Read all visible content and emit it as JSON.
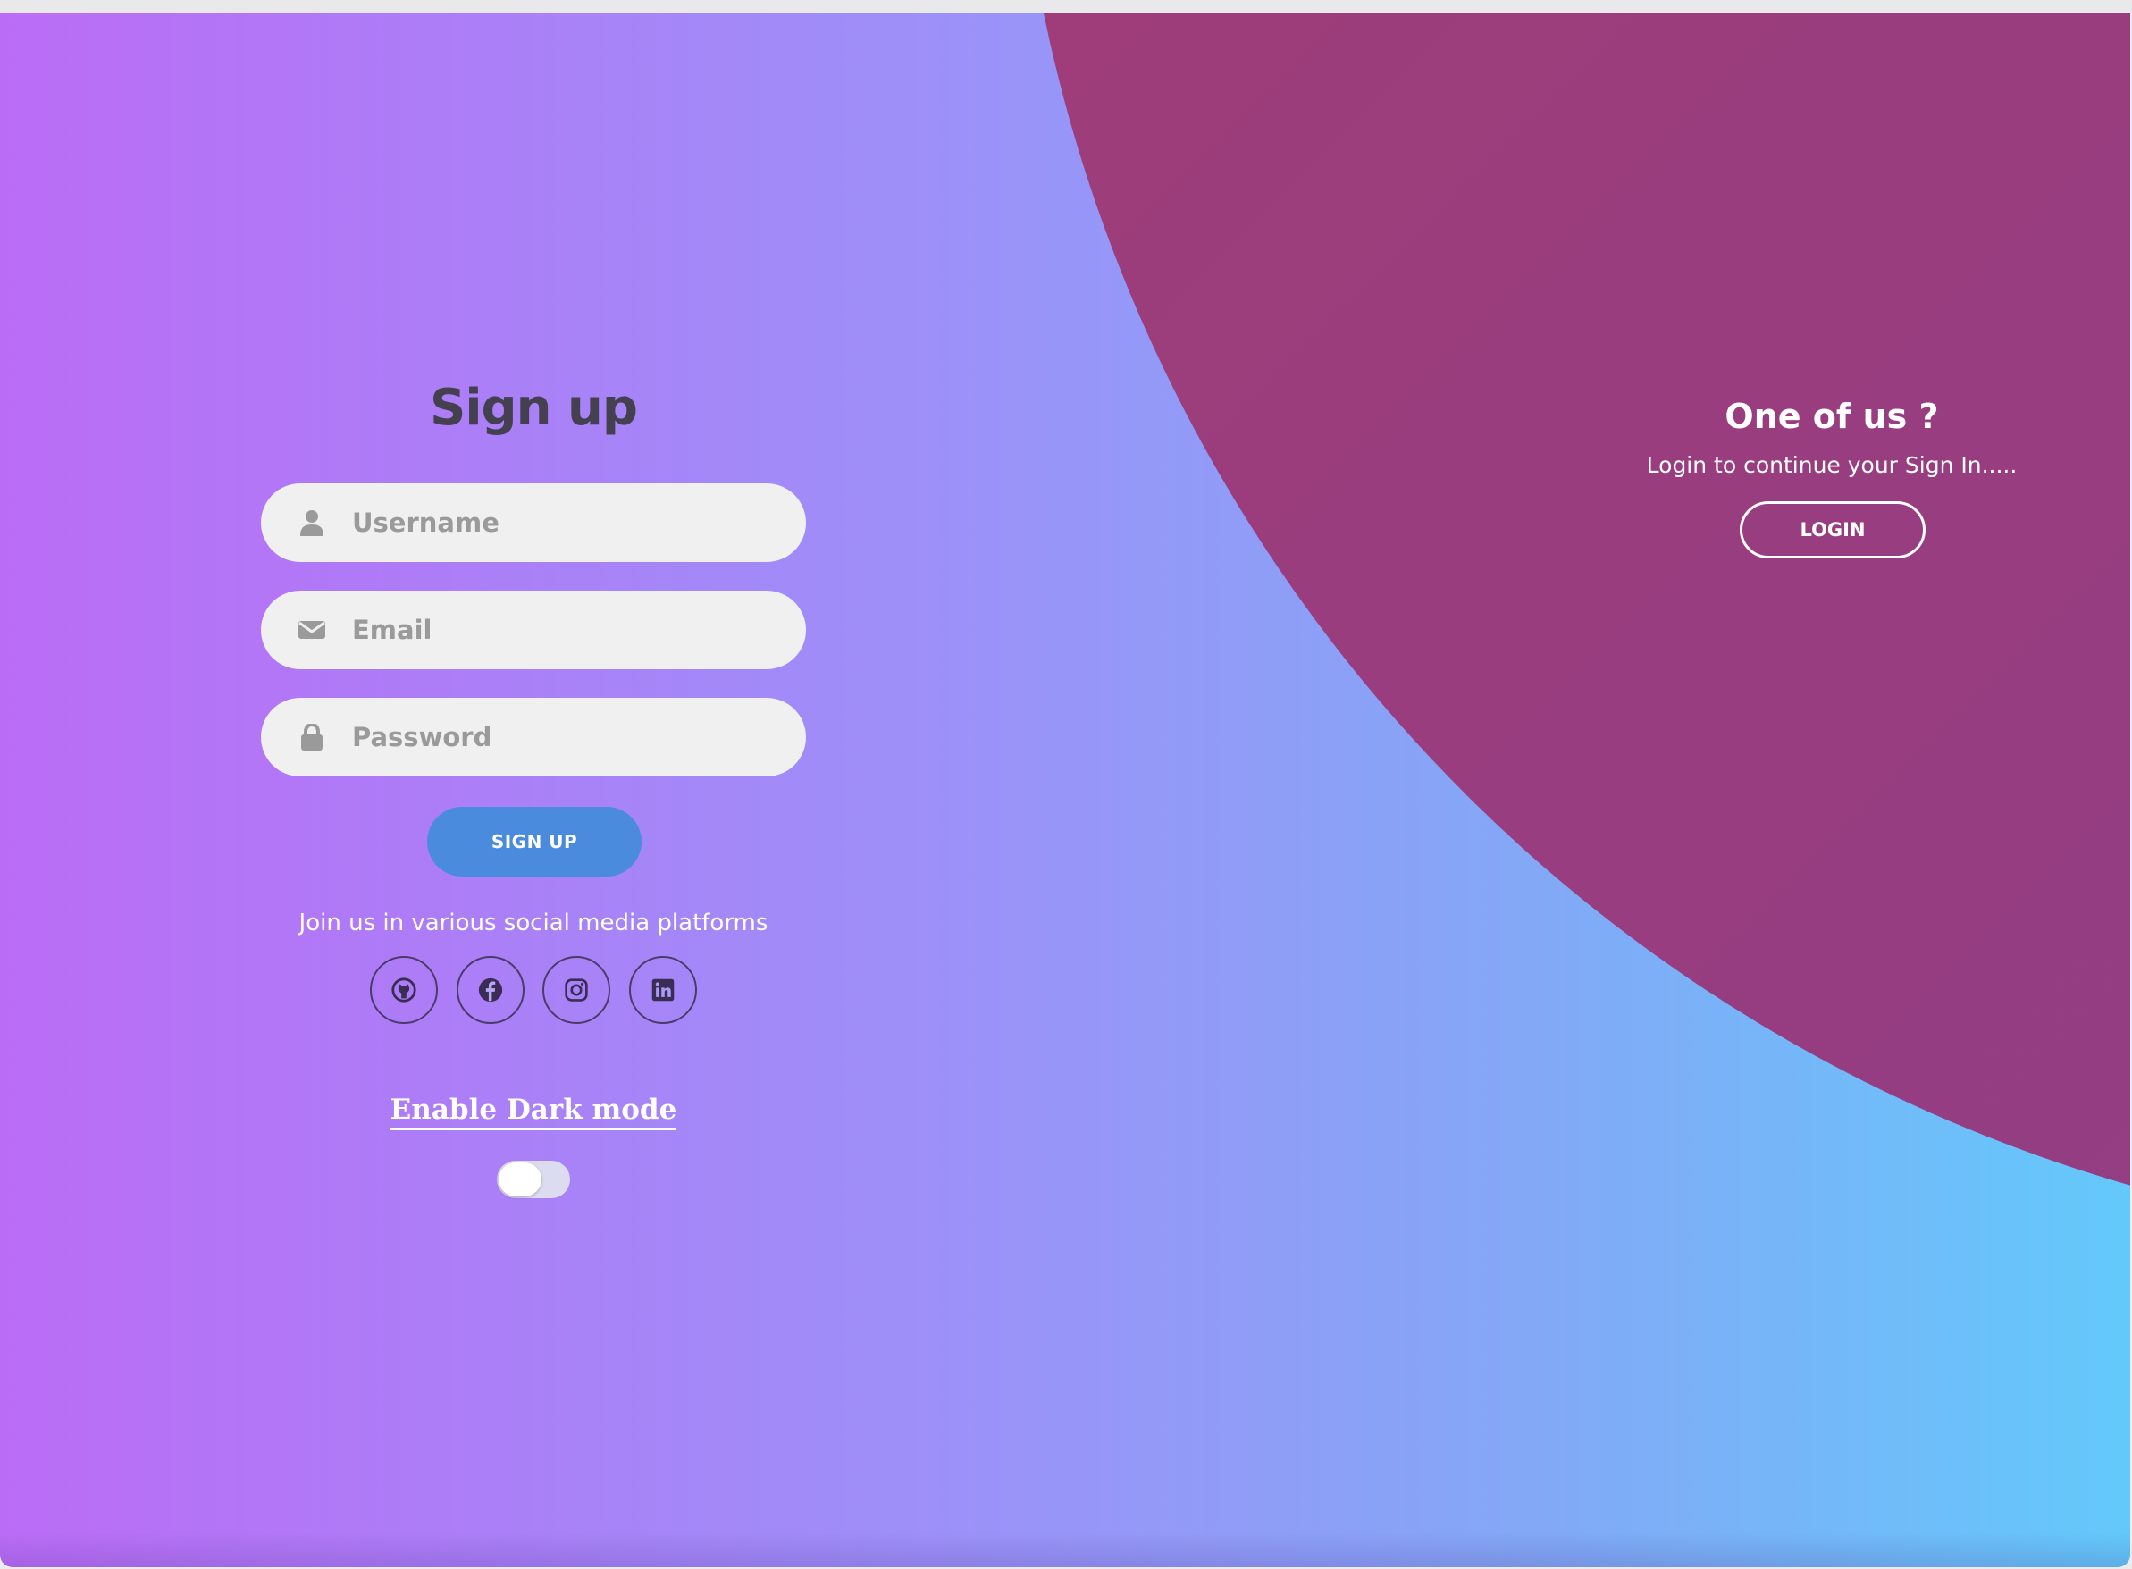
{
  "signup": {
    "title": "Sign up",
    "username_placeholder": "Username",
    "email_placeholder": "Email",
    "password_placeholder": "Password",
    "button_label": "SIGN UP",
    "social_text": "Join us in various social media platforms",
    "social_icons": [
      "github-icon",
      "facebook-icon",
      "instagram-icon",
      "linkedin-icon"
    ],
    "dark_mode_label": "Enable Dark mode",
    "dark_mode_enabled": false
  },
  "login": {
    "title": "One of us ?",
    "subtitle": "Login to continue your Sign In.....",
    "button_label": "LOGIN"
  },
  "colors": {
    "gradient_start": "#bb6cf6",
    "gradient_end": "#63c9fb",
    "panel_accent": "#a63c6e",
    "signup_button": "#4a8bde",
    "title_text": "#444050"
  }
}
